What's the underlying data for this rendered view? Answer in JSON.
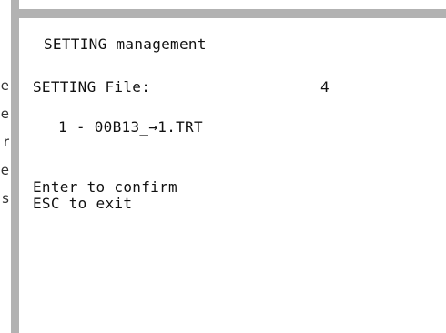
{
  "screen": {
    "title": "SETTING management",
    "file_label": "SETTING File:",
    "file_number": "4",
    "file_entry": "1 - 00B13_→1.TRT",
    "confirm_hint": "Enter to confirm",
    "exit_hint": "ESC to exit"
  },
  "left_margin": {
    "glyphs": [
      "e",
      "e",
      "r",
      "e",
      "s"
    ]
  },
  "colors": {
    "frame": "#b2b2b2",
    "text": "#111111",
    "background": "#ffffff"
  }
}
